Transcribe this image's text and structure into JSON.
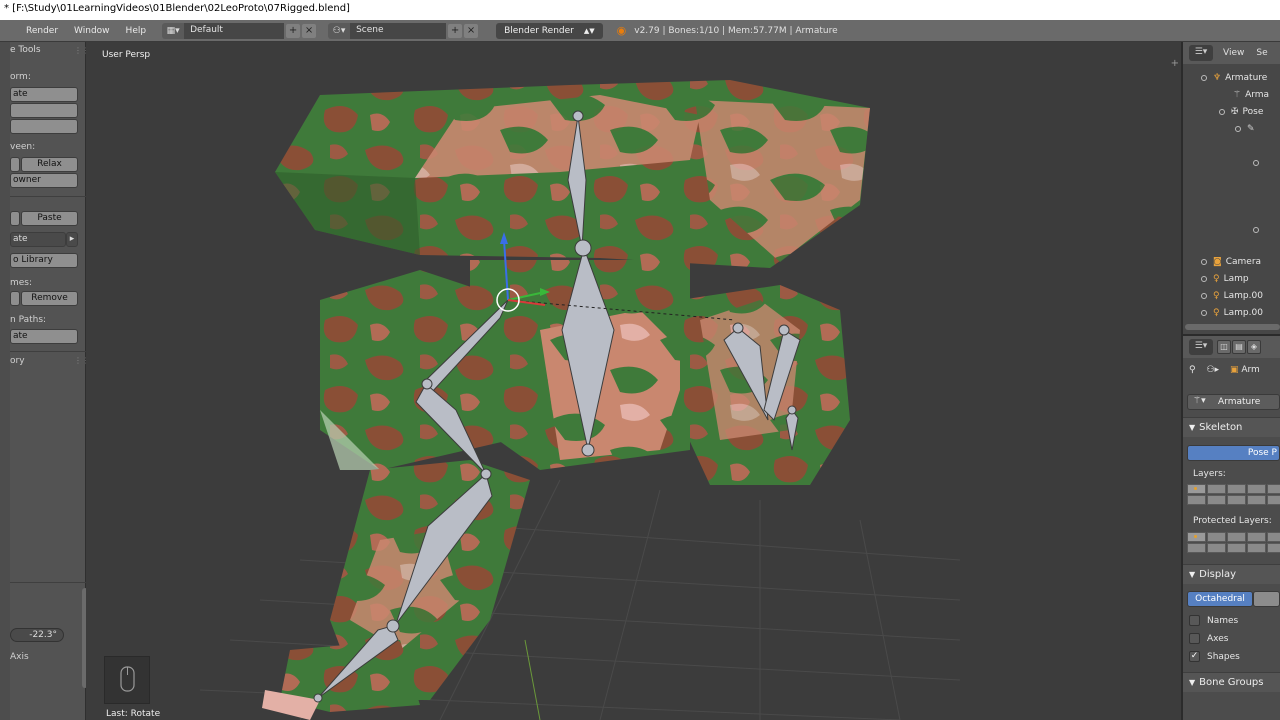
{
  "window": {
    "title": "* [F:\\Study\\01LearningVideos\\01Blender\\02LeoProto\\07Rigged.blend]"
  },
  "infobar": {
    "menus": [
      "Render",
      "Window",
      "Help"
    ],
    "screen_layout": "Default",
    "scene": "Scene",
    "render_engine": "Blender Render",
    "stats": "v2.79 | Bones:1/10 | Mem:57.77M | Armature"
  },
  "toolshelf": {
    "tab": "e Tools",
    "transform_label": "orm:",
    "rotate_btn": "ate",
    "inbetween_label": "veen:",
    "relax_btn": "Relax",
    "breakdowner_btn": "owner",
    "paste_btn": "Paste",
    "rotate2_btn": "ate",
    "library_btn": "o Library",
    "keyframes_label": "mes:",
    "remove_btn": "Remove",
    "motion_paths_label": "n Paths:",
    "calculate_btn": "ate",
    "history_label": "ory",
    "angle_value": "-22.3°",
    "axis_label": "Axis"
  },
  "viewport": {
    "view_label": "User Persp",
    "last_operator": "Last: Rotate"
  },
  "outliner": {
    "view_menu": "View",
    "search_menu": "Se",
    "items": [
      {
        "name": "Armature",
        "type": "armature-icon"
      },
      {
        "name": "Arma",
        "type": "armature-data-icon"
      },
      {
        "name": "Pose",
        "type": "pose-icon"
      },
      {
        "name": "Camera",
        "type": "camera-icon"
      },
      {
        "name": "Lamp",
        "type": "lamp-icon"
      },
      {
        "name": "Lamp.00",
        "type": "lamp-icon"
      },
      {
        "name": "Lamp.00",
        "type": "lamp-icon"
      }
    ]
  },
  "properties": {
    "context_object": "Arm",
    "datablock_name": "Armature",
    "skeleton": {
      "title": "Skeleton",
      "pose_position": "Pose P",
      "layers_label": "Layers:",
      "protected_label": "Protected Layers:"
    },
    "display": {
      "title": "Display",
      "mode": "Octahedral",
      "names_label": "Names",
      "axes_label": "Axes",
      "shapes_label": "Shapes",
      "names_checked": false,
      "axes_checked": false,
      "shapes_checked": true
    },
    "bone_groups": {
      "title": "Bone Groups"
    }
  },
  "colors": {
    "camo_green": "#3f7a3a",
    "camo_brown": "#8a4f36",
    "camo_pink": "#e3b0a6",
    "bone_fill": "#b9bdc6",
    "selection_blue": "#5680c2",
    "blender_orange": "#e87d0d"
  }
}
